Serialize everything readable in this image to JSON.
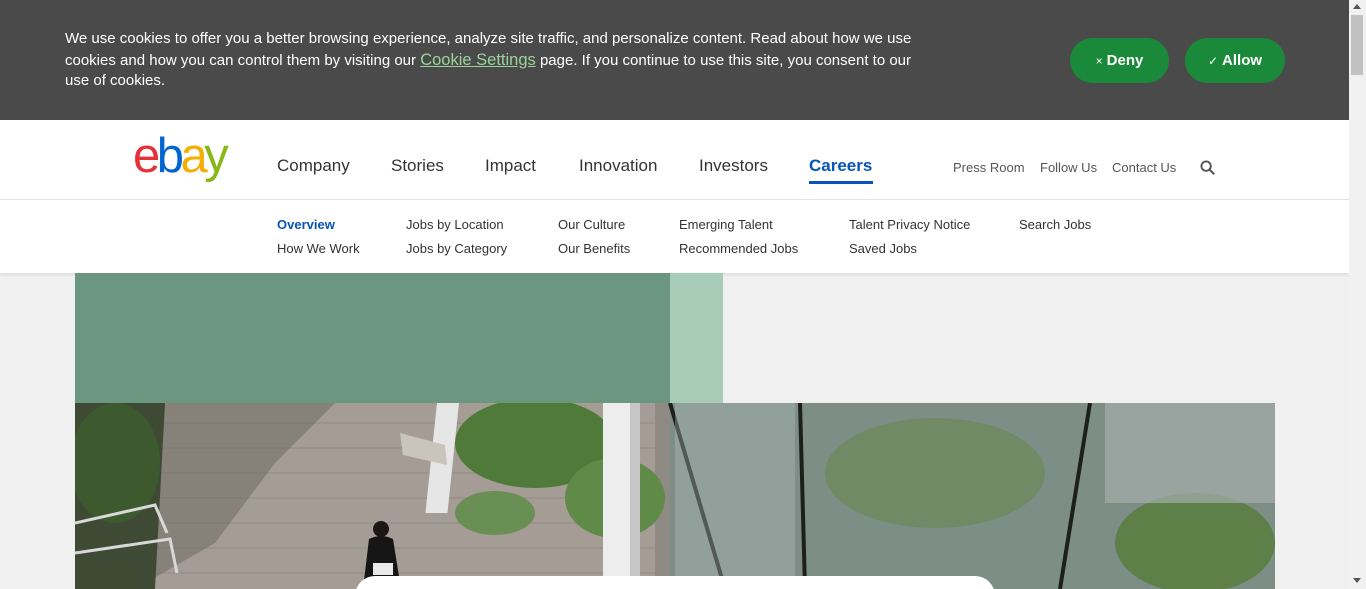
{
  "cookie_banner": {
    "text_before": "We use cookies to offer you a better browsing experience, analyze site traffic, and personalize content. Read about how we use cookies and how you can control them by visiting our ",
    "link_label": "Cookie Settings",
    "text_after": " page. If you continue to use this site, you consent to our use of cookies.",
    "deny_icon": "×",
    "deny_label": "Deny",
    "allow_icon": "✓",
    "allow_label": "Allow"
  },
  "header": {
    "logo": {
      "e": "e",
      "b": "b",
      "a": "a",
      "y": "y"
    },
    "nav": [
      {
        "label": "Company"
      },
      {
        "label": "Stories"
      },
      {
        "label": "Impact"
      },
      {
        "label": "Innovation"
      },
      {
        "label": "Investors"
      },
      {
        "label": "Careers",
        "active": true
      }
    ],
    "utility": [
      {
        "label": "Press Room"
      },
      {
        "label": "Follow Us"
      },
      {
        "label": "Contact Us"
      }
    ],
    "search_icon": "search-icon"
  },
  "subnav": {
    "items": [
      {
        "label": "Overview",
        "active": true
      },
      {
        "label": "How We Work"
      },
      {
        "label": "Jobs by Location"
      },
      {
        "label": "Jobs by Category"
      },
      {
        "label": "Our Culture"
      },
      {
        "label": "Our Benefits"
      },
      {
        "label": "Emerging Talent"
      },
      {
        "label": "Recommended Jobs"
      },
      {
        "label": "Talent Privacy Notice"
      },
      {
        "label": "Saved Jobs"
      },
      {
        "label": "Search Jobs"
      }
    ]
  },
  "colors": {
    "banner_bg": "#4a4a4a",
    "button_green": "#1a8a3a",
    "accent_blue": "#0654ba",
    "hero_green": "#6b9680",
    "hero_green_light": "#a8cdb6"
  }
}
